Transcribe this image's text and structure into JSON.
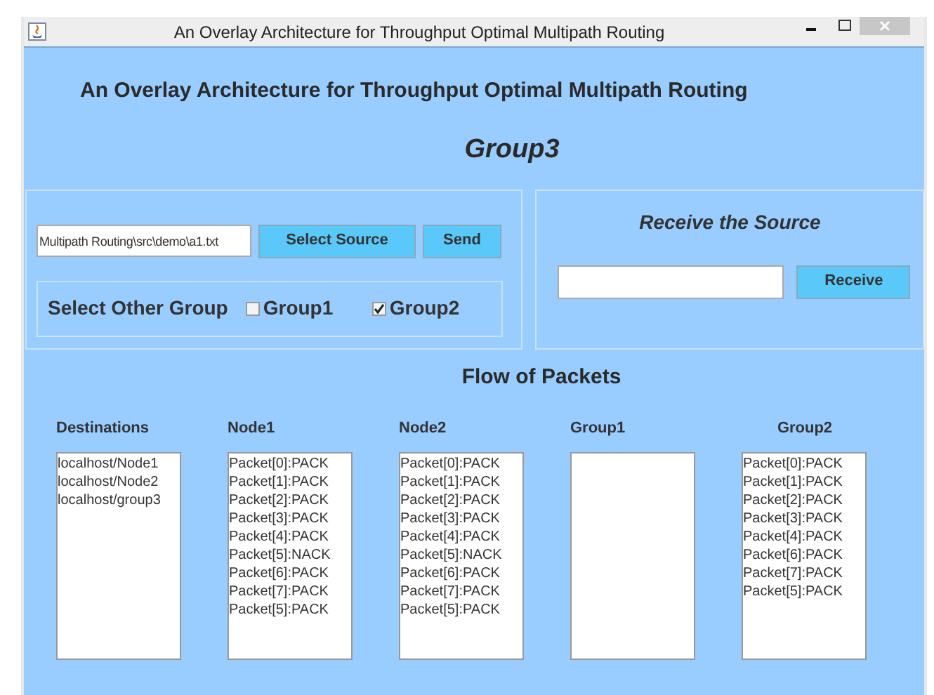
{
  "window": {
    "title": "An Overlay Architecture for Throughput Optimal Multipath Routing"
  },
  "heading": "An Overlay Architecture for Throughput Optimal Multipath Routing",
  "group_name": "Group3",
  "send_panel": {
    "file_field": {
      "value": "Multipath Routing\\src\\demo\\a1.txt"
    },
    "select_button": "Select Source",
    "send_button": "Send",
    "other_group": {
      "label": "Select Other Group",
      "options": [
        {
          "label": "Group1",
          "checked": false
        },
        {
          "label": "Group2",
          "checked": true
        }
      ]
    }
  },
  "receive_panel": {
    "title": "Receive the Source",
    "receive_button": "Receive"
  },
  "flow": {
    "title": "Flow of Packets",
    "columns": [
      {
        "heading": "Destinations",
        "items": [
          "localhost/Node1",
          "localhost/Node2",
          "localhost/group3"
        ]
      },
      {
        "heading": "Node1",
        "items": [
          "Packet[0]:PACK",
          "Packet[1]:PACK",
          "Packet[2]:PACK",
          "Packet[3]:PACK",
          "Packet[4]:PACK",
          "Packet[5]:NACK",
          "Packet[6]:PACK",
          "Packet[7]:PACK",
          "Packet[5]:PACK"
        ]
      },
      {
        "heading": "Node2",
        "items": [
          "Packet[0]:PACK",
          "Packet[1]:PACK",
          "Packet[2]:PACK",
          "Packet[3]:PACK",
          "Packet[4]:PACK",
          "Packet[5]:NACK",
          "Packet[6]:PACK",
          "Packet[7]:PACK",
          "Packet[5]:PACK"
        ]
      },
      {
        "heading": "Group1"
      },
      {
        "heading": "Group2",
        "items": [
          "Packet[0]:PACK",
          "Packet[1]:PACK",
          "Packet[2]:PACK",
          "Packet[3]:PACK",
          "Packet[4]:PACK",
          "Packet[6]:PACK",
          "Packet[7]:PACK",
          "Packet[5]:PACK"
        ]
      }
    ]
  }
}
